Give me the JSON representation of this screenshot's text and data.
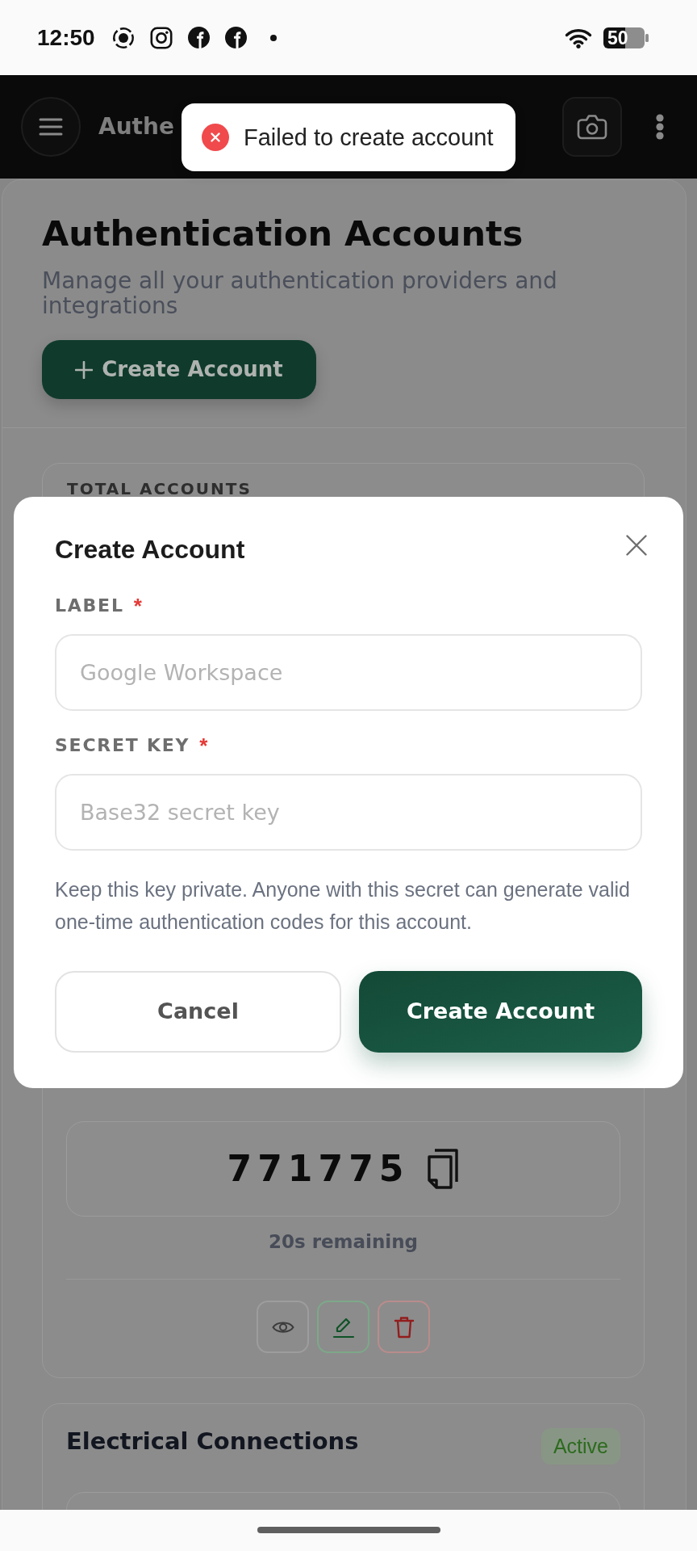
{
  "status_bar": {
    "time": "12:50",
    "battery": "50"
  },
  "app_bar": {
    "title": "Authe"
  },
  "toast": {
    "kind": "error",
    "message": "Failed to create account"
  },
  "page": {
    "title": "Authentication Accounts",
    "subtitle": "Manage all your authentication providers and integrations",
    "create_button": "Create Account"
  },
  "stats": {
    "label": "TOTAL ACCOUNTS"
  },
  "current_account": {
    "code": "771775",
    "remaining": "20s remaining"
  },
  "next_account": {
    "title": "Electrical Connections",
    "status": "Active"
  },
  "dialog": {
    "title": "Create Account",
    "fields": [
      {
        "label": "LABEL",
        "required_mark": "*",
        "placeholder": "Google Workspace"
      },
      {
        "label": "SECRET KEY",
        "required_mark": "*",
        "placeholder": "Base32 secret key"
      }
    ],
    "help": "Keep this key private. Anyone with this secret can generate valid one-time authentication codes for this account.",
    "buttons": [
      {
        "label": "Cancel",
        "kind": "secondary"
      },
      {
        "label": "Create Account",
        "kind": "primary"
      }
    ]
  }
}
